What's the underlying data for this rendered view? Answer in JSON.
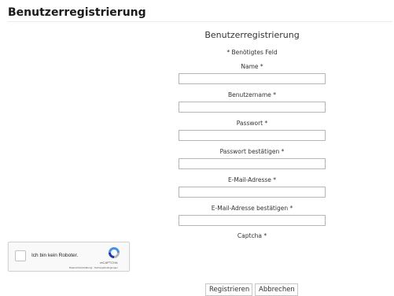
{
  "page": {
    "heading": "Benutzerregistrierung"
  },
  "form": {
    "title": "Benutzerregistrierung",
    "required_note": "* Benötigtes Feld",
    "fields": [
      {
        "label": "Name *",
        "value": "",
        "placeholder": ""
      },
      {
        "label": "Benutzername *",
        "value": "",
        "placeholder": ""
      },
      {
        "label": "Passwort *",
        "value": "",
        "placeholder": ""
      },
      {
        "label": "Passwort bestätigen *",
        "value": "",
        "placeholder": ""
      },
      {
        "label": "E-Mail-Adresse *",
        "value": "",
        "placeholder": ""
      },
      {
        "label": "E-Mail-Adresse bestätigen *",
        "value": "",
        "placeholder": ""
      }
    ],
    "captcha_label": "Captcha *"
  },
  "recaptcha": {
    "checkbox_label": "Ich bin kein Roboter.",
    "brand": "reCAPTCHA",
    "links": "Datenschutzerklärung - Nutzungsbedingungen",
    "checked": false,
    "logo_icon": "recaptcha-logo-icon",
    "colors": {
      "blue": "#4a90e2",
      "dark_blue": "#1c3aa9",
      "grey": "#b4b4b4"
    }
  },
  "buttons": {
    "register": "Registrieren",
    "cancel": "Abbrechen"
  }
}
